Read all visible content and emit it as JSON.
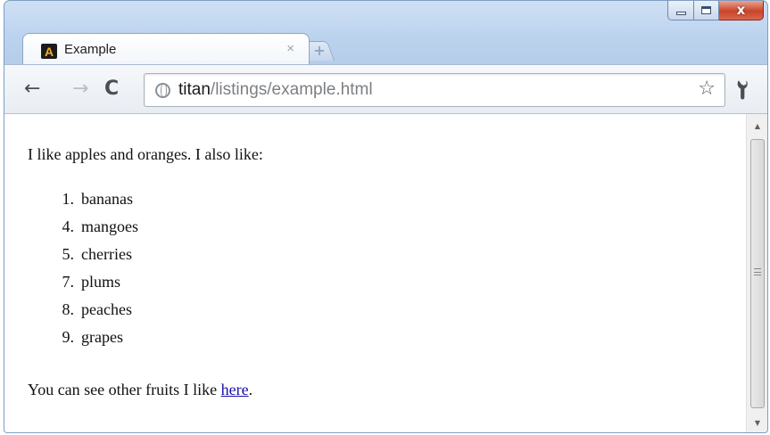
{
  "window": {
    "minimize_icon": "minimize-icon",
    "maximize_icon": "maximize-icon",
    "close_glyph": "x"
  },
  "tab": {
    "favicon_letter": "A",
    "title": "Example",
    "close_glyph": "×",
    "new_tab_glyph": "+"
  },
  "toolbar": {
    "back_glyph": "←",
    "forward_glyph": "→",
    "reload_glyph": "C",
    "url_host": "titan",
    "url_path": "/listings/example.html",
    "star_glyph": "☆",
    "wrench_glyph": "🔧"
  },
  "page": {
    "intro": "I like apples and oranges. I also like:",
    "items": [
      {
        "num": "1.",
        "label": "bananas"
      },
      {
        "num": "4.",
        "label": "mangoes"
      },
      {
        "num": "5.",
        "label": "cherries"
      },
      {
        "num": "7.",
        "label": "plums"
      },
      {
        "num": "8.",
        "label": "peaches"
      },
      {
        "num": "9.",
        "label": "grapes"
      }
    ],
    "outro_prefix": "You can see other fruits I like ",
    "link_text": "here",
    "outro_suffix": "."
  },
  "colors": {
    "link": "#1a0dab",
    "chrome_frame": "#bcd3ee"
  }
}
